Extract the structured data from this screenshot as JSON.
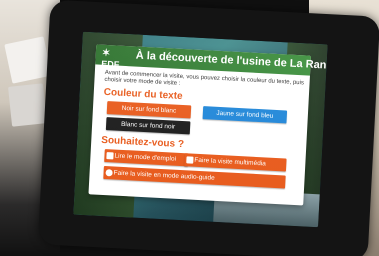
{
  "kiosk": {
    "logo_text": "EDF",
    "title": "À la découverte de l'usine de La Rance",
    "intro": "Avant de commencer la visite, vous pouvez choisir la couleur du texte, puis choisir votre mode de visite :",
    "section_color": "Couleur du texte",
    "btn_orange_white": "Noir sur fond blanc",
    "btn_blue": "Jaune sur fond bleu",
    "btn_black_white": "Blanc sur fond noir",
    "section_wish": "Souhaitez-vous ?",
    "btn_instructions": "Lire le mode d'emploi",
    "btn_multimedia": "Faire la visite multimédia",
    "btn_audio": "Faire la visite en mode audio-guide"
  },
  "colors": {
    "accent_orange": "#e85a1b",
    "accent_blue": "#1f86d8",
    "header_green": "#2a6f2a"
  }
}
